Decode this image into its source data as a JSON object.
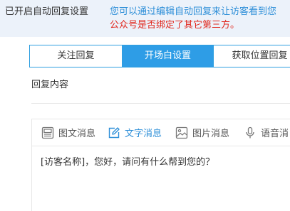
{
  "header": {
    "status": "已开启自动回复设置",
    "notice_line1": "您可以通过编辑自动回复来让访客看到您",
    "notice_line2": "公众号是否绑定了其它第三方。"
  },
  "tabs": [
    {
      "label": "关注回复",
      "active": false
    },
    {
      "label": "开场白设置",
      "active": true
    },
    {
      "label": "获取位置回复",
      "active": false
    }
  ],
  "section_label": "回复内容",
  "toolbar": {
    "items": [
      {
        "label": "图文消息",
        "icon": "news-icon",
        "active": false
      },
      {
        "label": "文字消息",
        "icon": "edit-icon",
        "active": true
      },
      {
        "label": "图片消息",
        "icon": "image-icon",
        "active": false
      },
      {
        "label": "语音消",
        "icon": "microphone-icon",
        "active": false
      }
    ]
  },
  "editor": {
    "text": "[访客名称]，您好，请问有什么帮到您的？"
  },
  "colors": {
    "accent": "#2e9de6",
    "notice_blue": "#2e8fd8",
    "notice_red": "#e1251b",
    "header_bg": "#ecf2fa"
  }
}
